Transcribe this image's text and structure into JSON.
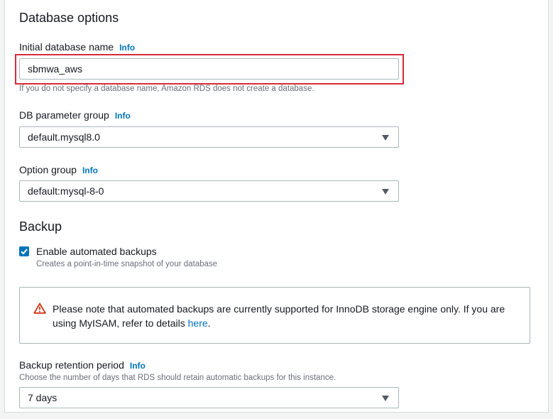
{
  "database_options": {
    "title": "Database options",
    "initial_db_name": {
      "label": "Initial database name",
      "info": "Info",
      "value": "sbmwa_aws",
      "hint": "If you do not specify a database name, Amazon RDS does not create a database."
    },
    "db_parameter_group": {
      "label": "DB parameter group",
      "info": "Info",
      "value": "default.mysql8.0"
    },
    "option_group": {
      "label": "Option group",
      "info": "Info",
      "value": "default:mysql-8-0"
    }
  },
  "backup": {
    "title": "Backup",
    "enable_automated": {
      "label": "Enable automated backups",
      "checked": true,
      "hint": "Creates a point-in-time snapshot of your database"
    },
    "alert": {
      "text_before_link": "Please note that automated backups are currently supported for InnoDB storage engine only. If you are using MyISAM, refer to details ",
      "link_text": "here",
      "text_after_link": "."
    },
    "retention_period": {
      "label": "Backup retention period",
      "info": "Info",
      "hint": "Choose the number of days that RDS should retain automatic backups for this instance.",
      "value": "7 days"
    }
  },
  "colors": {
    "highlight": "#d62b3b",
    "link": "#0073bb",
    "warning": "#d13212"
  }
}
